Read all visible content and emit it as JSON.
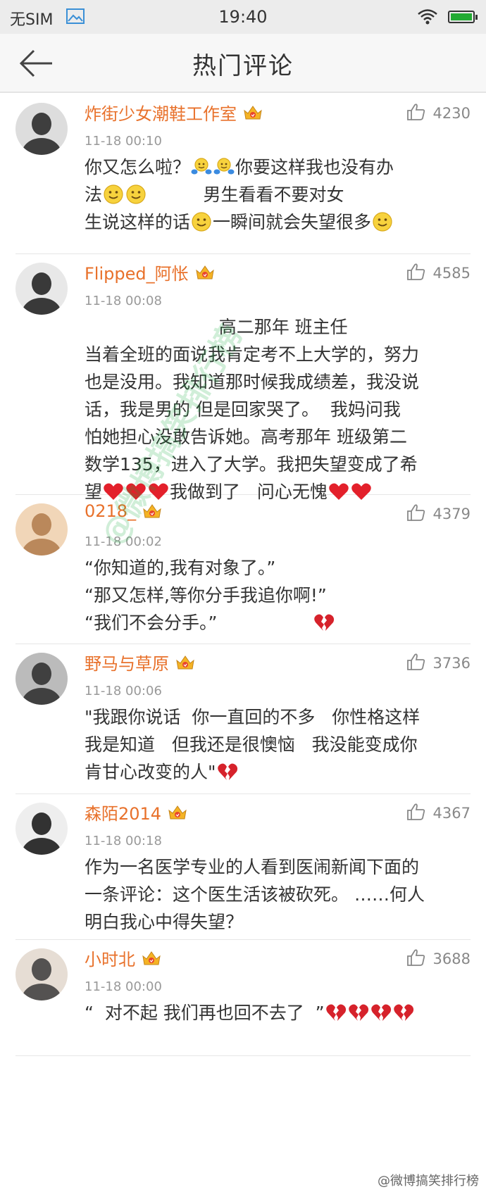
{
  "status": {
    "carrier": "无SIM",
    "time": "19:40"
  },
  "nav": {
    "title": "热门评论",
    "back_icon": "arrow-left-icon"
  },
  "colors": {
    "username": "#e8712b",
    "time": "#999999",
    "watermark": "#14aa3c"
  },
  "comments": [
    {
      "username": "炸街少女潮鞋工作室",
      "time": "11-18 00:10",
      "likes": "4230",
      "lines": [
        "你又怎么啦？[hug][hug]你要这样我也没有办",
        "法[smile][smile]          男生看看不要对女",
        "生说这样的话[smile]一瞬间就会失望很多[smile]"
      ]
    },
    {
      "username": "Flipped_阿怅",
      "time": "11-18 00:08",
      "likes": "4585",
      "lines": [
        "                        高二那年 班主任",
        "当着全班的面说我肯定考不上大学的，努力",
        "也是没用。我知道那时候我成绩差，我没说",
        "话，我是男的 但是回家哭了。  我妈问我",
        "怕她担心没敢告诉她。高考那年 班级第二",
        "数学135，进入了大学。我把失望变成了希",
        "望[heart][heart][heart]我做到了   问心无愧[heart][heart]"
      ]
    },
    {
      "username": "0218_",
      "time": "11-18 00:02",
      "likes": "4379",
      "lines": [
        "“你知道的,我有对象了。”",
        "“那又怎样,等你分手我追你啊!”",
        "“我们不会分手。”                 [broken]"
      ]
    },
    {
      "username": "野马与草原",
      "time": "11-18 00:06",
      "likes": "3736",
      "lines": [
        "\"我跟你说话  你一直回的不多   你性格这样",
        "我是知道   但我还是很懊恼   我没能变成你",
        "肯甘心改变的人\"[broken]"
      ]
    },
    {
      "username": "森陌2014",
      "time": "11-18 00:18",
      "likes": "4367",
      "lines": [
        "作为一名医学专业的人看到医闹新闻下面的",
        "一条评论：这个医生活该被砍死。 ……何人",
        "明白我心中得失望？"
      ]
    },
    {
      "username": "小时北",
      "time": "11-18 00:00",
      "likes": "3688",
      "lines": [
        "“  对不起 我们再也回不去了  ”[broken][broken][broken][broken]"
      ]
    }
  ],
  "watermark": "@微博搞笑排行榜",
  "footer_credit": "@微博搞笑排行榜"
}
